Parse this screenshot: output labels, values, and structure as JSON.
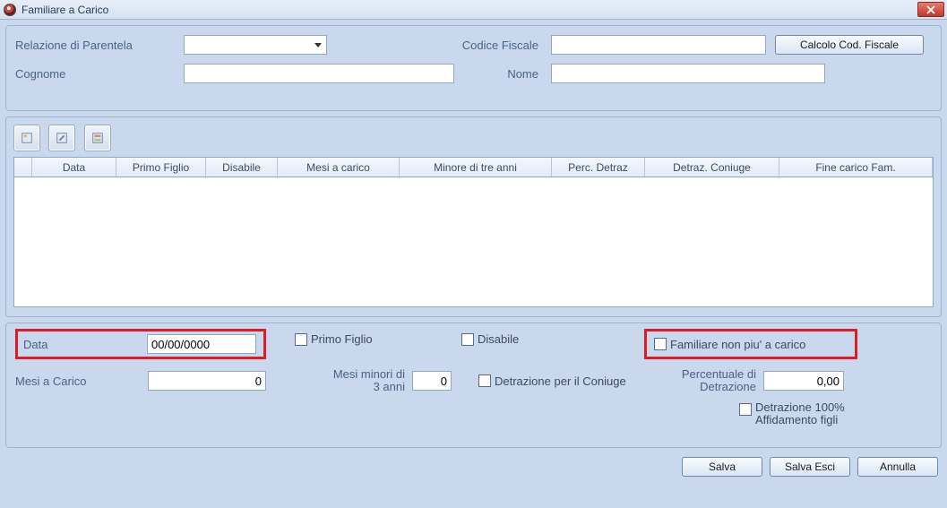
{
  "window": {
    "title": "Familiare a Carico"
  },
  "top": {
    "relazione_label": "Relazione di Parentela",
    "relazione_value": "",
    "codice_label": "Codice Fiscale",
    "codice_value": "",
    "calcolo_btn": "Calcolo Cod. Fiscale",
    "cognome_label": "Cognome",
    "cognome_value": "",
    "nome_label": "Nome",
    "nome_value": ""
  },
  "table": {
    "headers": [
      "Data",
      "Primo Figlio",
      "Disabile",
      "Mesi a carico",
      "Minore di tre anni",
      "Perc. Detraz",
      "Detraz. Coniuge",
      "Fine carico Fam."
    ]
  },
  "bottom": {
    "data_label": "Data",
    "data_value": "00/00/0000",
    "primo_figlio": "Primo Figlio",
    "disabile": "Disabile",
    "familiare_non_piu": "Familiare non piu' a carico",
    "mesi_carico_label": "Mesi a Carico",
    "mesi_carico_value": "0",
    "mesi_minori_label": "Mesi minori di 3 anni",
    "mesi_minori_value": "0",
    "detrazione_coniuge": "Detrazione per il Coniuge",
    "perc_detraz_label": "Percentuale di Detrazione",
    "perc_detraz_value": "0,00",
    "detraz_100": "Detrazione 100% Affidamento figli"
  },
  "footer": {
    "salva": "Salva",
    "salva_esci": "Salva Esci",
    "annulla": "Annulla"
  }
}
